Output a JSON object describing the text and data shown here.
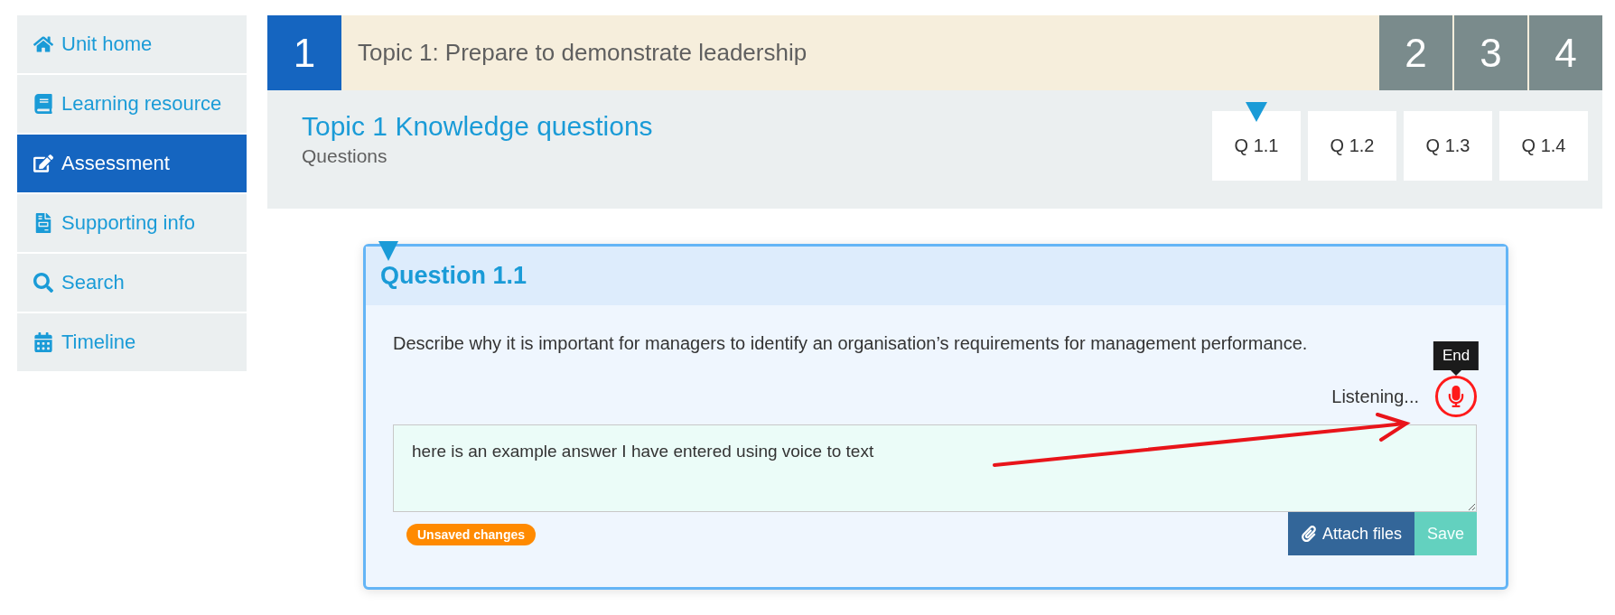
{
  "sidebar": {
    "items": [
      {
        "label": "Unit home",
        "selected": false
      },
      {
        "label": "Learning resource",
        "selected": false
      },
      {
        "label": "Assessment",
        "selected": true
      },
      {
        "label": "Supporting info",
        "selected": false
      },
      {
        "label": "Search",
        "selected": false
      },
      {
        "label": "Timeline",
        "selected": false
      }
    ]
  },
  "topic_tabs": [
    {
      "label": "1",
      "selected": true
    },
    {
      "label": "2",
      "selected": false
    },
    {
      "label": "3",
      "selected": false
    },
    {
      "label": "4",
      "selected": false
    }
  ],
  "topic_title": "Topic 1: Prepare to demonstrate leadership",
  "section": {
    "title": "Topic 1 Knowledge questions",
    "subtitle": "Questions"
  },
  "question_tabs": [
    {
      "label": "Q 1.1",
      "selected": true
    },
    {
      "label": "Q 1.2",
      "selected": false
    },
    {
      "label": "Q 1.3",
      "selected": false
    },
    {
      "label": "Q 1.4",
      "selected": false
    }
  ],
  "question": {
    "title": "Question 1.1",
    "text": "Describe why it is important for managers to identify an organisation’s requirements for management performance.",
    "status": "Listening...",
    "tooltip": "End",
    "listening": true,
    "answer": "here is an example answer I have entered using voice to text",
    "badge": "Unsaved changes",
    "buttons": [
      {
        "label": "Attach files",
        "kind": "attach"
      },
      {
        "label": "Save",
        "kind": "save"
      }
    ]
  }
}
